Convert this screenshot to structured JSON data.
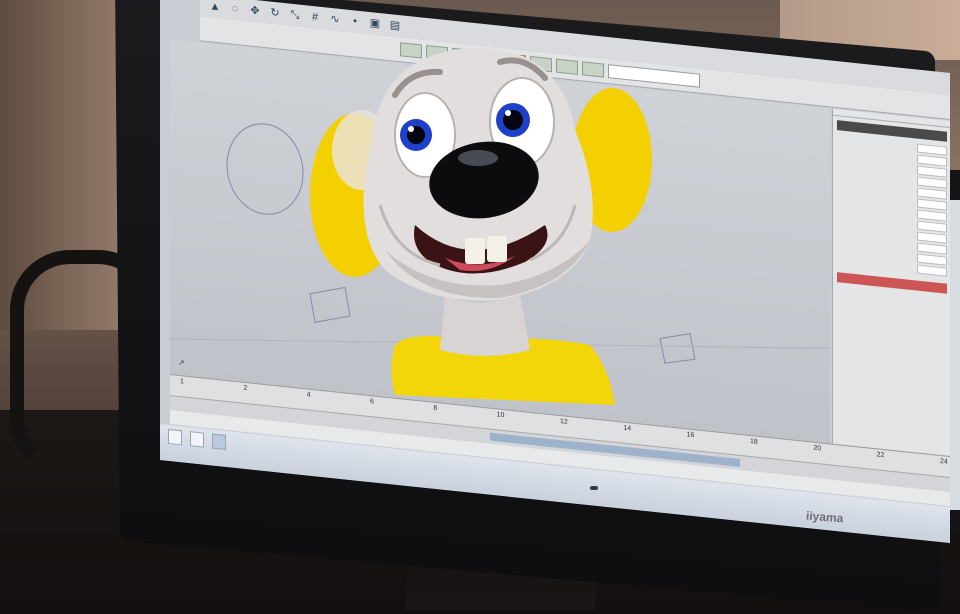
{
  "monitor": {
    "brand": "iiyama"
  },
  "app": {
    "menu_icons": [
      "select-icon",
      "lasso-icon",
      "move-icon",
      "rotate-icon",
      "scale-icon",
      "snap-grid-icon",
      "snap-curve-icon",
      "snap-point-icon",
      "render-icon",
      "ipr-icon"
    ],
    "toolbar_buttons": [
      "",
      "",
      "",
      "",
      "",
      "",
      "",
      ""
    ],
    "timeline": {
      "start": 1,
      "end": 24,
      "ticks": [
        "1",
        "2",
        "4",
        "6",
        "8",
        "10",
        "12",
        "14",
        "16",
        "18",
        "20",
        "22",
        "24"
      ]
    },
    "attribute_editor": {
      "rows": [
        "",
        "",
        "",
        "",
        "",
        "",
        "",
        "",
        "",
        "",
        "",
        ""
      ]
    },
    "taskbar": {
      "items": [
        "",
        "",
        ""
      ],
      "clock": ""
    }
  },
  "colors": {
    "character_body": "#e0dcdc",
    "character_yellow": "#f5d400",
    "character_iris": "#1e3fc8",
    "nose": "#0c0c0f",
    "viewport_bg": "#c7cbd1"
  }
}
